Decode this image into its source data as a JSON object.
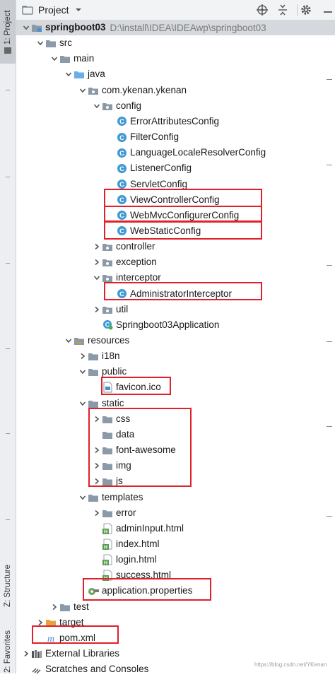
{
  "side_tabs": {
    "project": "1: Project",
    "structure": "Z: Structure",
    "favorites": "2: Favorites"
  },
  "toolbar": {
    "title": "Project"
  },
  "tree": [
    {
      "label": "springboot03",
      "path": "D:\\install\\IDEA\\IDEAwp\\springboot03",
      "level": 0,
      "arrow": "down",
      "icon": "folder-module",
      "bold": true,
      "selected": true
    },
    {
      "label": "src",
      "level": 1,
      "arrow": "down",
      "icon": "folder"
    },
    {
      "label": "main",
      "level": 2,
      "arrow": "down",
      "icon": "folder"
    },
    {
      "label": "java",
      "level": 3,
      "arrow": "down",
      "icon": "folder-source"
    },
    {
      "label": "com.ykenan.ykenan",
      "level": 4,
      "arrow": "down",
      "icon": "package"
    },
    {
      "label": "config",
      "level": 5,
      "arrow": "down",
      "icon": "package"
    },
    {
      "label": "ErrorAttributesConfig",
      "level": 6,
      "icon": "class"
    },
    {
      "label": "FilterConfig",
      "level": 6,
      "icon": "class"
    },
    {
      "label": "LanguageLocaleResolverConfig",
      "level": 6,
      "icon": "class"
    },
    {
      "label": "ListenerConfig",
      "level": 6,
      "icon": "class"
    },
    {
      "label": "ServletConfig",
      "level": 6,
      "icon": "class"
    },
    {
      "label": "ViewControllerConfig",
      "level": 6,
      "icon": "class"
    },
    {
      "label": "WebMvcConfigurerConfig",
      "level": 6,
      "icon": "class"
    },
    {
      "label": "WebStaticConfig",
      "level": 6,
      "icon": "class"
    },
    {
      "label": "controller",
      "level": 5,
      "arrow": "right",
      "icon": "package"
    },
    {
      "label": "exception",
      "level": 5,
      "arrow": "right",
      "icon": "package"
    },
    {
      "label": "interceptor",
      "level": 5,
      "arrow": "down",
      "icon": "package"
    },
    {
      "label": "AdministratorInterceptor",
      "level": 6,
      "icon": "class"
    },
    {
      "label": "util",
      "level": 5,
      "arrow": "right",
      "icon": "package"
    },
    {
      "label": "Springboot03Application",
      "level": 5,
      "icon": "app-class"
    },
    {
      "label": "resources",
      "level": 3,
      "arrow": "down",
      "icon": "folder-resources"
    },
    {
      "label": "i18n",
      "level": 4,
      "arrow": "right",
      "icon": "folder"
    },
    {
      "label": "public",
      "level": 4,
      "arrow": "down",
      "icon": "folder"
    },
    {
      "label": "favicon.ico",
      "level": 5,
      "icon": "file"
    },
    {
      "label": "static",
      "level": 4,
      "arrow": "down",
      "icon": "folder"
    },
    {
      "label": "css",
      "level": 5,
      "arrow": "right",
      "icon": "folder"
    },
    {
      "label": "data",
      "level": 5,
      "icon": "folder"
    },
    {
      "label": "font-awesome",
      "level": 5,
      "arrow": "right",
      "icon": "folder"
    },
    {
      "label": "img",
      "level": 5,
      "arrow": "right",
      "icon": "folder"
    },
    {
      "label": "js",
      "level": 5,
      "arrow": "right",
      "icon": "folder"
    },
    {
      "label": "templates",
      "level": 4,
      "arrow": "down",
      "icon": "folder"
    },
    {
      "label": "error",
      "level": 5,
      "arrow": "right",
      "icon": "folder"
    },
    {
      "label": "adminInput.html",
      "level": 5,
      "icon": "html"
    },
    {
      "label": "index.html",
      "level": 5,
      "icon": "html"
    },
    {
      "label": "login.html",
      "level": 5,
      "icon": "html"
    },
    {
      "label": "success.html",
      "level": 5,
      "icon": "html"
    },
    {
      "label": "application.properties",
      "level": 4,
      "icon": "properties"
    },
    {
      "label": "test",
      "level": 2,
      "arrow": "right",
      "icon": "folder"
    },
    {
      "label": "target",
      "level": 1,
      "arrow": "right",
      "icon": "folder-orange"
    },
    {
      "label": "pom.xml",
      "level": 1,
      "icon": "maven"
    },
    {
      "label": "External Libraries",
      "level": 0,
      "arrow": "right",
      "icon": "libraries"
    },
    {
      "label": "Scratches and Consoles",
      "level": 0,
      "icon": "scratches"
    }
  ],
  "watermark": "https://blog.csdn.net/YKenan",
  "colors": {
    "highlight": "#e0202a",
    "selection": "#d5d8dc",
    "folder": "#8b9aa8",
    "class_icon": "#3d9ad4"
  }
}
